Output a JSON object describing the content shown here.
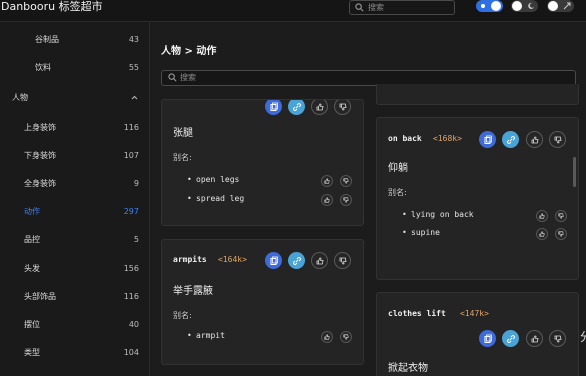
{
  "app": {
    "title": "Danbooru 标签超市",
    "search_placeholder": "搜索"
  },
  "sidebar": {
    "items": [
      {
        "label": "谷制品",
        "count": "43"
      },
      {
        "label": "饮料",
        "count": "55"
      },
      {
        "label": "人物",
        "count": ""
      },
      {
        "label": "上身装饰",
        "count": "116"
      },
      {
        "label": "下身装饰",
        "count": "107"
      },
      {
        "label": "全身装饰",
        "count": "9"
      },
      {
        "label": "动作",
        "count": "297"
      },
      {
        "label": "品控",
        "count": "5"
      },
      {
        "label": "头发",
        "count": "156"
      },
      {
        "label": "头部饰品",
        "count": "116"
      },
      {
        "label": "摆位",
        "count": "40"
      },
      {
        "label": "类型",
        "count": "104"
      }
    ]
  },
  "main": {
    "breadcrumb": "人物 > 动作",
    "filter_placeholder": "搜索",
    "alias_label": "别名:",
    "cards": [
      {
        "tag": "",
        "count": "",
        "name": "张腿",
        "aliases": [
          "open legs",
          "spread leg"
        ]
      },
      {
        "tag": "armpits",
        "count": "<164k>",
        "name": "举手露腋",
        "aliases": [
          "armpit"
        ]
      },
      {
        "tag": "on back",
        "count": "<168k>",
        "name": "仰躺",
        "aliases": [
          "lying on back",
          "supine"
        ]
      },
      {
        "tag": "clothes lift",
        "count": "<147k>",
        "name": "掀起衣物",
        "aliases": []
      }
    ],
    "edge_glyph": "分"
  },
  "colors": {
    "accent": "#3b82f6",
    "count_tag": "#e0a46a",
    "copy_button": "#3f6bd8",
    "link_button": "#4aa3d6"
  },
  "icons": [
    "search-icon",
    "sun-icon",
    "moon-icon",
    "expand-icon",
    "chevron-up-icon",
    "copy-icon",
    "link-icon",
    "thumbs-up-icon",
    "thumbs-down-icon"
  ]
}
